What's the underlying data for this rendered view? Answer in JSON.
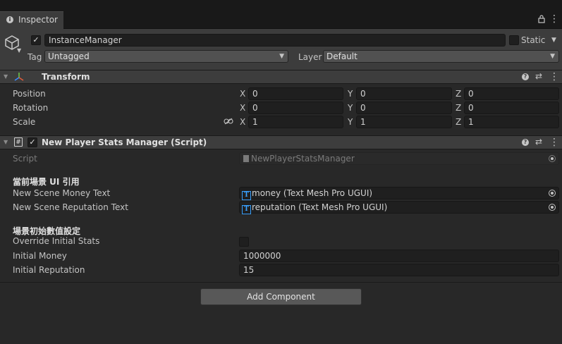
{
  "tab": {
    "label": "Inspector"
  },
  "gameobject": {
    "name": "InstanceManager",
    "active": true,
    "static_label": "Static",
    "tag_label": "Tag",
    "tag_value": "Untagged",
    "layer_label": "Layer",
    "layer_value": "Default"
  },
  "transform": {
    "title": "Transform",
    "rows": [
      {
        "label": "Position",
        "x": "0",
        "y": "0",
        "z": "0"
      },
      {
        "label": "Rotation",
        "x": "0",
        "y": "0",
        "z": "0"
      },
      {
        "label": "Scale",
        "x": "1",
        "y": "1",
        "z": "1"
      }
    ],
    "axes": {
      "x": "X",
      "y": "Y",
      "z": "Z"
    }
  },
  "script_component": {
    "title": "New Player Stats Manager (Script)",
    "enabled": true,
    "script_label": "Script",
    "script_value": "NewPlayerStatsManager",
    "section1_title": "當前場景 UI 引用",
    "money_text_label": "New Scene Money Text",
    "money_text_value": "money (Text Mesh Pro UGUI)",
    "reputation_text_label": "New Scene Reputation Text",
    "reputation_text_value": "reputation (Text Mesh Pro UGUI)",
    "section2_title": "場景初始數值設定",
    "override_label": "Override Initial Stats",
    "override_checked": false,
    "initial_money_label": "Initial Money",
    "initial_money_value": "1000000",
    "initial_reputation_label": "Initial Reputation",
    "initial_reputation_value": "15"
  },
  "add_component": {
    "label": "Add Component"
  }
}
